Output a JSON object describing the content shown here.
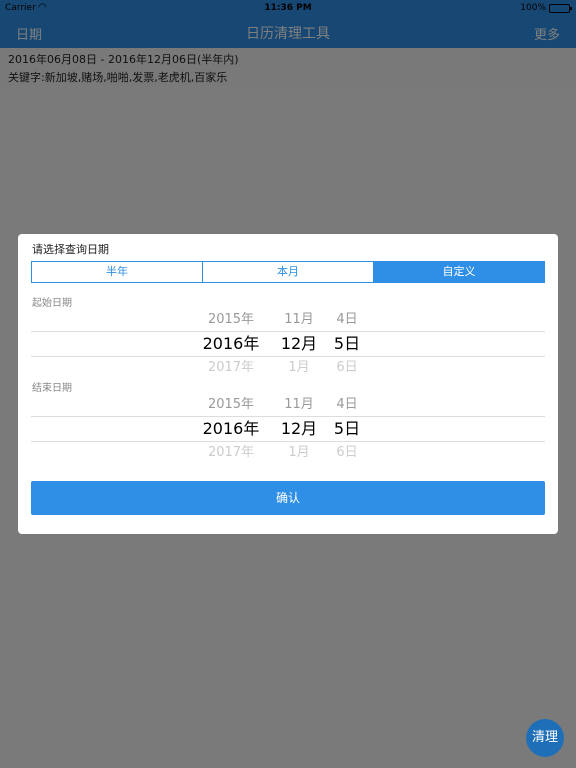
{
  "status_bar": {
    "carrier": "Carrier",
    "time": "11:36 PM",
    "battery": "100%"
  },
  "nav": {
    "left": "日期",
    "title": "日历清理工具",
    "right": "更多"
  },
  "info": {
    "range": "2016年06月08日 - 2016年12月06日(半年内)",
    "keywords": "关键字:新加坡,赌场,啪啪,发票,老虎机,百家乐"
  },
  "dialog": {
    "title": "请选择查询日期",
    "segments": [
      {
        "label": "半年",
        "active": false
      },
      {
        "label": "本月",
        "active": false
      },
      {
        "label": "自定义",
        "active": true
      }
    ],
    "start": {
      "label": "起始日期",
      "above": {
        "y": "2015年",
        "m": "11月",
        "d": "4日"
      },
      "selected": {
        "y": "2016年",
        "m": "12月",
        "d": "5日"
      },
      "below": {
        "y": "2017年",
        "m": "1月",
        "d": "6日"
      }
    },
    "end": {
      "label": "结束日期",
      "above": {
        "y": "2015年",
        "m": "11月",
        "d": "4日"
      },
      "selected": {
        "y": "2016年",
        "m": "12月",
        "d": "5日"
      },
      "below": {
        "y": "2017年",
        "m": "1月",
        "d": "6日"
      }
    },
    "confirm": "确认"
  },
  "fab": "清理",
  "colors": {
    "accent": "#2f8fe6"
  }
}
